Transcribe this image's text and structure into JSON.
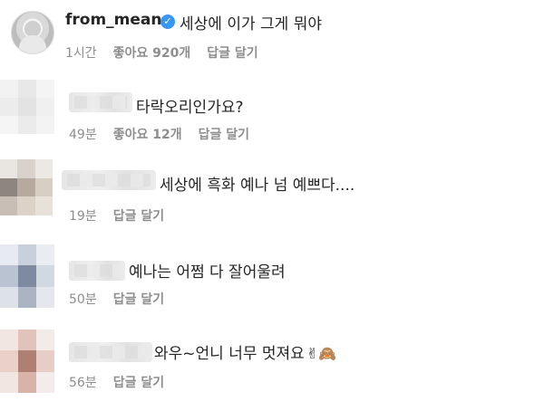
{
  "main_post": {
    "username": "from_mean",
    "verified_glyph": "✓",
    "text": "세상에 이가 그게 뭐야",
    "time": "1시간",
    "likes": "좋아요 920개",
    "reply_label": "답글 달기"
  },
  "comments": [
    {
      "text": "타락오리인가요?",
      "time": "49분",
      "likes": "좋아요 12개",
      "reply_label": "답글 달기"
    },
    {
      "text": "세상에 흑화 예나 넘 예쁘다....",
      "time": "19분",
      "reply_label": "답글 달기"
    },
    {
      "text": "예나는 어쩜 다 잘어울려",
      "time": "50분",
      "reply_label": "답글 달기"
    },
    {
      "text": "와우~언니 너무 멋져요",
      "emojis": "✌🙈",
      "time": "56분",
      "reply_label": "답글 달기"
    }
  ],
  "colors": {
    "text": "#262626",
    "meta": "#8e8e8e",
    "verified": "#3897f0"
  },
  "icons": [
    "verified-badge-icon",
    "avatar"
  ]
}
